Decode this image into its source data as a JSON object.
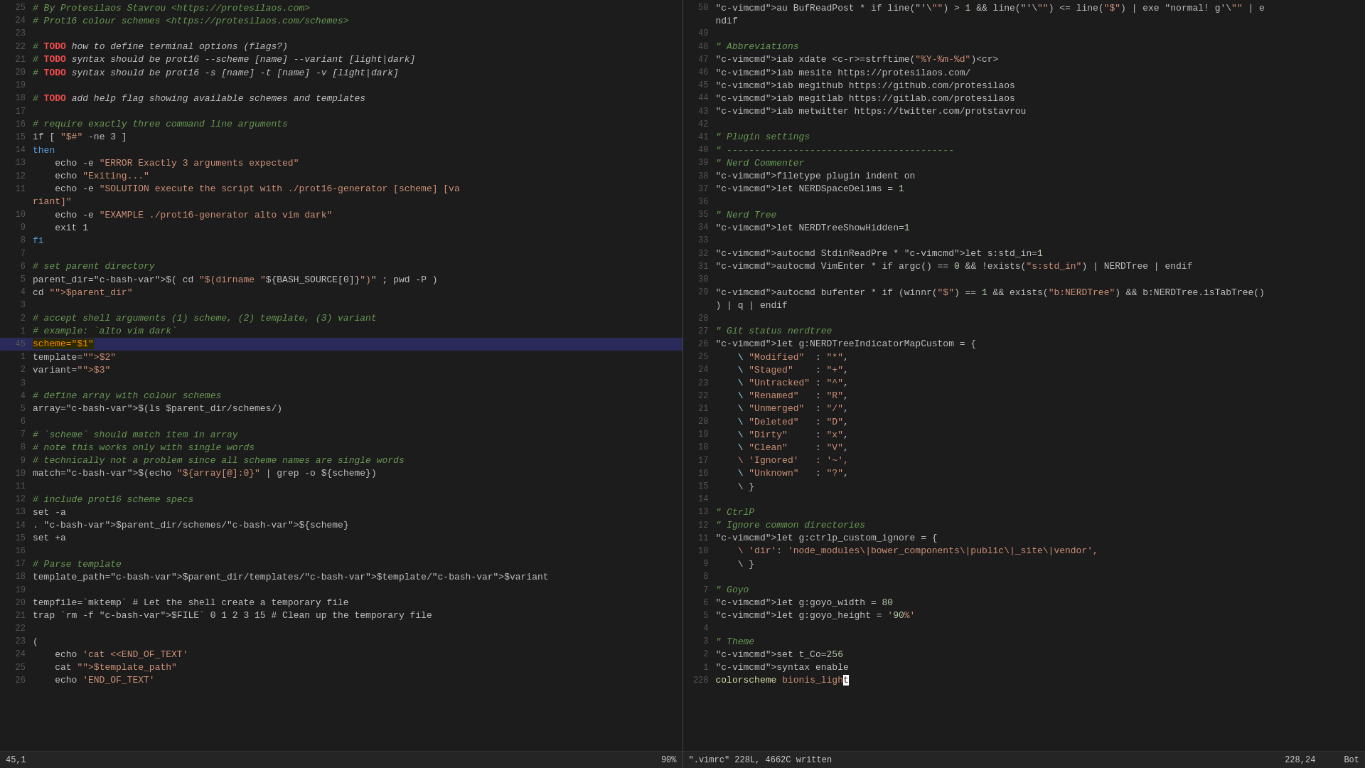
{
  "pane_left": {
    "lines": [
      {
        "num": "25",
        "content": "# By Protesilaos Stavrou <https://protesilaos.com>",
        "type": "comment"
      },
      {
        "num": "24",
        "content": "# Prot16 colour schemes <https://protesilaos.com/schemes>",
        "type": "comment"
      },
      {
        "num": "23",
        "content": "",
        "type": "plain"
      },
      {
        "num": "22",
        "content": "# TODO how to define terminal options (flags?)",
        "type": "todo"
      },
      {
        "num": "21",
        "content": "# TODO syntax should be prot16 --scheme [name] --variant [light|dark]",
        "type": "todo"
      },
      {
        "num": "20",
        "content": "# TODO syntax should be prot16 -s [name] -t [name] -v [light|dark]",
        "type": "todo"
      },
      {
        "num": "19",
        "content": "",
        "type": "plain"
      },
      {
        "num": "18",
        "content": "# TODO add help flag showing available schemes and templates",
        "type": "todo"
      },
      {
        "num": "17",
        "content": "",
        "type": "plain"
      },
      {
        "num": "16",
        "content": "# require exactly three command line arguments",
        "type": "comment"
      },
      {
        "num": "15",
        "content": "if [ \"$#\" -ne 3 ]",
        "type": "bash"
      },
      {
        "num": "14",
        "content": "then",
        "type": "keyword"
      },
      {
        "num": "13",
        "content": "    echo -e \"ERROR Exactly 3 arguments expected\"",
        "type": "echo"
      },
      {
        "num": "12",
        "content": "    echo \"Exiting...\"",
        "type": "echo"
      },
      {
        "num": "11",
        "content": "    echo -e \"SOLUTION execute the script with ./prot16-generator [scheme] [va",
        "type": "echo"
      },
      {
        "num": "",
        "content": "riant]\"",
        "type": "echo-cont"
      },
      {
        "num": "10",
        "content": "    echo -e \"EXAMPLE ./prot16-generator alto vim dark\"",
        "type": "echo"
      },
      {
        "num": "9",
        "content": "    exit 1",
        "type": "bash"
      },
      {
        "num": "8",
        "content": "fi",
        "type": "keyword-fi"
      },
      {
        "num": "7",
        "content": "",
        "type": "plain"
      },
      {
        "num": "6",
        "content": "# set parent directory",
        "type": "comment"
      },
      {
        "num": "5",
        "content": "parent_dir=$( cd \"$(dirname \"${BASH_SOURCE[0]}\")\" ; pwd -P )",
        "type": "bash"
      },
      {
        "num": "4",
        "content": "cd \"$parent_dir\"",
        "type": "bash"
      },
      {
        "num": "3",
        "content": "",
        "type": "plain"
      },
      {
        "num": "2",
        "content": "# accept shell arguments (1) scheme, (2) template, (3) variant",
        "type": "comment"
      },
      {
        "num": "1",
        "content": "# example: `alto vim dark`",
        "type": "comment"
      },
      {
        "num": "45",
        "content": "scheme=\"$1\"",
        "type": "highlighted"
      },
      {
        "num": "1",
        "content": "template=\"$2\"",
        "type": "bash"
      },
      {
        "num": "2",
        "content": "variant=\"$3\"",
        "type": "bash"
      },
      {
        "num": "3",
        "content": "",
        "type": "plain"
      },
      {
        "num": "4",
        "content": "# define array with colour schemes",
        "type": "comment"
      },
      {
        "num": "5",
        "content": "array=$(ls $parent_dir/schemes/)",
        "type": "bash"
      },
      {
        "num": "6",
        "content": "",
        "type": "plain"
      },
      {
        "num": "7",
        "content": "# `scheme` should match item in array",
        "type": "comment"
      },
      {
        "num": "8",
        "content": "# note this works only with single words",
        "type": "comment"
      },
      {
        "num": "9",
        "content": "# technically not a problem since all scheme names are single words",
        "type": "comment"
      },
      {
        "num": "10",
        "content": "match=$(echo \"${array[@]:0}\" | grep -o ${scheme})",
        "type": "bash-match"
      },
      {
        "num": "11",
        "content": "",
        "type": "plain"
      },
      {
        "num": "12",
        "content": "# include prot16 scheme specs",
        "type": "comment"
      },
      {
        "num": "13",
        "content": "set -a",
        "type": "bash"
      },
      {
        "num": "14",
        "content": ". $parent_dir/schemes/${scheme}",
        "type": "bash"
      },
      {
        "num": "15",
        "content": "set +a",
        "type": "bash"
      },
      {
        "num": "16",
        "content": "",
        "type": "plain"
      },
      {
        "num": "17",
        "content": "# Parse template",
        "type": "comment"
      },
      {
        "num": "18",
        "content": "template_path=$parent_dir/templates/$template/$variant",
        "type": "bash"
      },
      {
        "num": "19",
        "content": "",
        "type": "plain"
      },
      {
        "num": "20",
        "content": "tempfile=`mktemp` # Let the shell create a temporary file",
        "type": "bash"
      },
      {
        "num": "21",
        "content": "trap `rm -f $FILE` 0 1 2 3 15 # Clean up the temporary file",
        "type": "bash"
      },
      {
        "num": "22",
        "content": "",
        "type": "plain"
      },
      {
        "num": "23",
        "content": "(",
        "type": "bash"
      },
      {
        "num": "24",
        "content": "    echo 'cat <<END_OF_TEXT'",
        "type": "echo"
      },
      {
        "num": "25",
        "content": "    cat \"$template_path\"",
        "type": "bash"
      },
      {
        "num": "26",
        "content": "    echo 'END_OF_TEXT'",
        "type": "echo"
      }
    ],
    "status": "45,1",
    "percent": "90%",
    "filename": ""
  },
  "pane_right": {
    "lines": [
      {
        "num": "50",
        "content": "au BufReadPost * if line(\"'\\\"\") > 1 && line(\"'\\\"\") <= line(\"$\") | exe \"normal! g'\\\"\" | e",
        "type": "vim"
      },
      {
        "num": "",
        "content": "ndif",
        "type": "vim-cont"
      },
      {
        "num": "49",
        "content": "",
        "type": "plain"
      },
      {
        "num": "48",
        "content": "\" Abbreviations",
        "type": "vimcomment"
      },
      {
        "num": "47",
        "content": "iab xdate <c-r>=strftime(\"%Y-%m-%d\")<cr>",
        "type": "vim"
      },
      {
        "num": "46",
        "content": "iab mesite https://protesilaos.com/",
        "type": "vim"
      },
      {
        "num": "45",
        "content": "iab megithub https://github.com/protesilaos",
        "type": "vim"
      },
      {
        "num": "44",
        "content": "iab megitlab https://gitlab.com/protesilaos",
        "type": "vim"
      },
      {
        "num": "43",
        "content": "iab metwitter https://twitter.com/protstavrou",
        "type": "vim"
      },
      {
        "num": "42",
        "content": "",
        "type": "plain"
      },
      {
        "num": "41",
        "content": "\" Plugin settings",
        "type": "vimcomment"
      },
      {
        "num": "40",
        "content": "\" -----------------------------------------",
        "type": "vimcomment"
      },
      {
        "num": "39",
        "content": "\" Nerd Commenter",
        "type": "vimcomment"
      },
      {
        "num": "38",
        "content": "filetype plugin indent on",
        "type": "vim"
      },
      {
        "num": "37",
        "content": "let NERDSpaceDelims = 1",
        "type": "vim"
      },
      {
        "num": "36",
        "content": "",
        "type": "plain"
      },
      {
        "num": "35",
        "content": "\" Nerd Tree",
        "type": "vimcomment"
      },
      {
        "num": "34",
        "content": "let NERDTreeShowHidden=1",
        "type": "vim"
      },
      {
        "num": "33",
        "content": "",
        "type": "plain"
      },
      {
        "num": "32",
        "content": "autocmd StdinReadPre * let s:std_in=1",
        "type": "vim"
      },
      {
        "num": "31",
        "content": "autocmd VimEnter * if argc() == 0 && !exists(\"s:std_in\") | NERDTree | endif",
        "type": "vim"
      },
      {
        "num": "30",
        "content": "",
        "type": "plain"
      },
      {
        "num": "29",
        "content": "autocmd bufenter * if (winnr(\"$\") == 1 && exists(\"b:NERDTree\") && b:NERDTree.isTabTree()",
        "type": "vim"
      },
      {
        "num": "",
        "content": ") | q | endif",
        "type": "vim-cont"
      },
      {
        "num": "28",
        "content": "",
        "type": "plain"
      },
      {
        "num": "27",
        "content": "\" Git status nerdtree",
        "type": "vimcomment"
      },
      {
        "num": "26",
        "content": "let g:NERDTreeIndicatorMapCustom = {",
        "type": "vim"
      },
      {
        "num": "25",
        "content": "    \\ \"Modified\"  : \"*\",",
        "type": "vim-map"
      },
      {
        "num": "24",
        "content": "    \\ \"Staged\"    : \"+\",",
        "type": "vim-map"
      },
      {
        "num": "23",
        "content": "    \\ \"Untracked\" : \"^\",",
        "type": "vim-map"
      },
      {
        "num": "22",
        "content": "    \\ \"Renamed\"   : \"R\",",
        "type": "vim-map"
      },
      {
        "num": "21",
        "content": "    \\ \"Unmerged\"  : \"/\",",
        "type": "vim-map"
      },
      {
        "num": "20",
        "content": "    \\ \"Deleted\"   : \"D\",",
        "type": "vim-map"
      },
      {
        "num": "19",
        "content": "    \\ \"Dirty\"     : \"x\",",
        "type": "vim-map"
      },
      {
        "num": "18",
        "content": "    \\ \"Clean\"     : \"V\",",
        "type": "vim-map"
      },
      {
        "num": "17",
        "content": "    \\ 'Ignored'   : '~',",
        "type": "vim-map"
      },
      {
        "num": "16",
        "content": "    \\ \"Unknown\"   : \"?\",",
        "type": "vim-map"
      },
      {
        "num": "15",
        "content": "    \\ }",
        "type": "vim"
      },
      {
        "num": "14",
        "content": "",
        "type": "plain"
      },
      {
        "num": "13",
        "content": "\" CtrlP",
        "type": "vimcomment"
      },
      {
        "num": "12",
        "content": "\" Ignore common directories",
        "type": "vimcomment"
      },
      {
        "num": "11",
        "content": "let g:ctrlp_custom_ignore = {",
        "type": "vim"
      },
      {
        "num": "10",
        "content": "    \\ 'dir': 'node_modules\\|bower_components\\|public\\|_site\\|vendor',",
        "type": "vim-map"
      },
      {
        "num": "9",
        "content": "    \\ }",
        "type": "vim"
      },
      {
        "num": "8",
        "content": "",
        "type": "plain"
      },
      {
        "num": "7",
        "content": "\" Goyo",
        "type": "vimcomment"
      },
      {
        "num": "6",
        "content": "let g:goyo_width = 80",
        "type": "vim"
      },
      {
        "num": "5",
        "content": "let g:goyo_height = '90%'",
        "type": "vim"
      },
      {
        "num": "4",
        "content": "",
        "type": "plain"
      },
      {
        "num": "3",
        "content": "\" Theme",
        "type": "vimcomment"
      },
      {
        "num": "2",
        "content": "set t_Co=256",
        "type": "vim"
      },
      {
        "num": "1",
        "content": "syntax enable",
        "type": "vim"
      },
      {
        "num": "228",
        "content": "colorscheme bionis_light",
        "type": "vim-cursor"
      }
    ],
    "status": "228,24",
    "filename": "\".vimrc\" 228L, 4662C written",
    "bot": "Bot"
  }
}
